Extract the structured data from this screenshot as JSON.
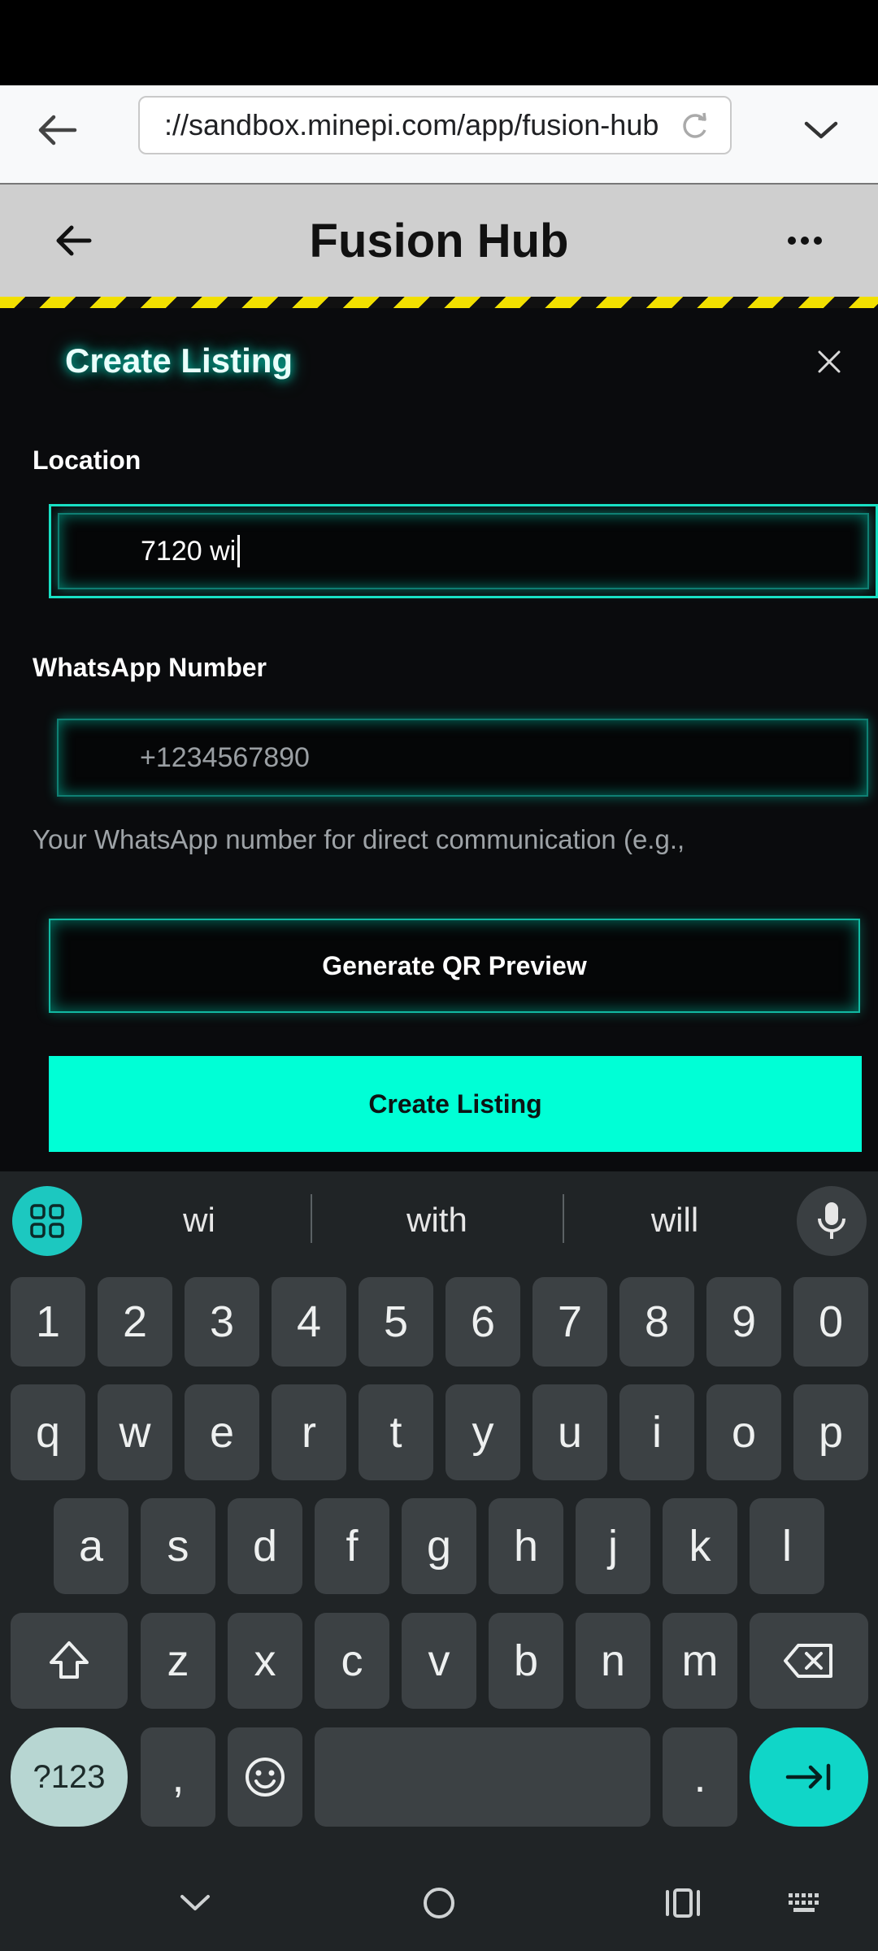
{
  "browser": {
    "url": "://sandbox.minepi.com/app/fusion-hub"
  },
  "app": {
    "title": "Fusion Hub"
  },
  "form": {
    "title": "Create Listing",
    "location_label": "Location",
    "location_value": "7120 wi",
    "whatsapp_label": "WhatsApp Number",
    "whatsapp_placeholder": "+1234567890",
    "whatsapp_help": "Your WhatsApp number for direct communication (e.g.,",
    "qr_button": "Generate QR Preview",
    "create_button": "Create Listing"
  },
  "keyboard": {
    "suggestions": [
      "wi",
      "with",
      "will"
    ],
    "number_row": [
      "1",
      "2",
      "3",
      "4",
      "5",
      "6",
      "7",
      "8",
      "9",
      "0"
    ],
    "row1": [
      "q",
      "w",
      "e",
      "r",
      "t",
      "y",
      "u",
      "i",
      "o",
      "p"
    ],
    "row2": [
      "a",
      "s",
      "d",
      "f",
      "g",
      "h",
      "j",
      "k",
      "l"
    ],
    "row3": [
      "z",
      "x",
      "c",
      "v",
      "b",
      "n",
      "m"
    ],
    "symbols_key": "?123",
    "comma_key": ",",
    "period_key": "."
  }
}
